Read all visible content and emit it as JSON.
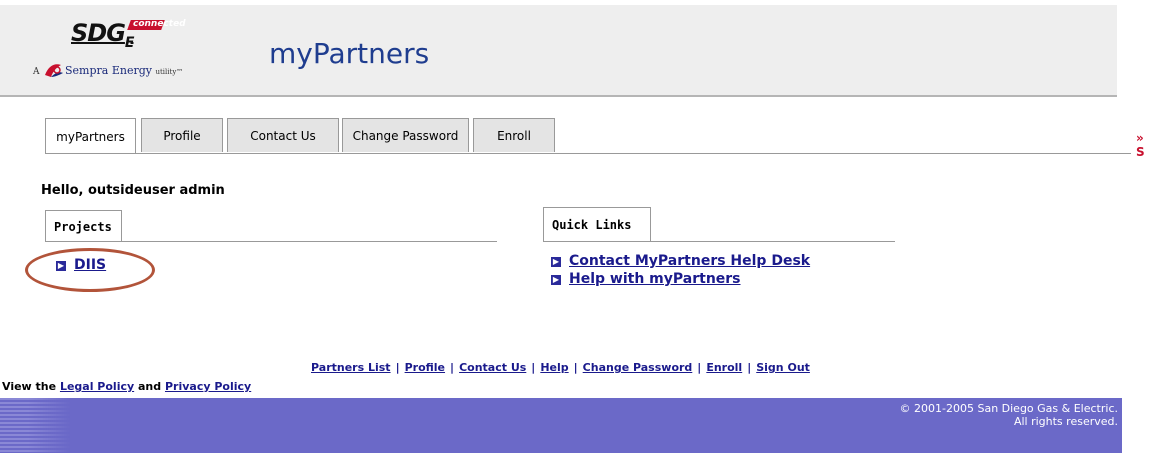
{
  "logo": {
    "brand": "SDG",
    "brand_suffix": "E",
    "tagline": "connected",
    "parent_prefix": "A",
    "parent_name": "Sempra Energy",
    "parent_suffix": "utility",
    "brand_color": "#c8102e"
  },
  "app_title": "myPartners",
  "tabs": [
    {
      "label": "myPartners",
      "active": true
    },
    {
      "label": "Profile",
      "active": false
    },
    {
      "label": "Contact Us",
      "active": false
    },
    {
      "label": "Change Password",
      "active": false
    },
    {
      "label": "Enroll",
      "active": false
    }
  ],
  "more_link": "» S",
  "greeting": "Hello, outsideuser admin",
  "projects": {
    "title": "Projects",
    "items": [
      {
        "label": "DIIS"
      }
    ]
  },
  "quick_links": {
    "title": "Quick Links",
    "items": [
      {
        "label": "Contact MyPartners Help Desk"
      },
      {
        "label": "Help with myPartners"
      }
    ]
  },
  "footer_links": [
    "Partners List",
    "Profile",
    "Contact Us",
    "Help",
    "Change Password",
    "Enroll",
    "Sign Out"
  ],
  "policy": {
    "prefix": "View the",
    "legal": "Legal Policy",
    "and": "and",
    "privacy": "Privacy Policy"
  },
  "copyright": {
    "line1": "© 2001-2005 San Diego Gas & Electric.",
    "line2": "All rights reserved."
  },
  "colors": {
    "title_blue": "#1f3d8f",
    "link_blue": "#1a1a8c",
    "footer_purple": "#6b69c8",
    "highlight": "#b2543a"
  }
}
